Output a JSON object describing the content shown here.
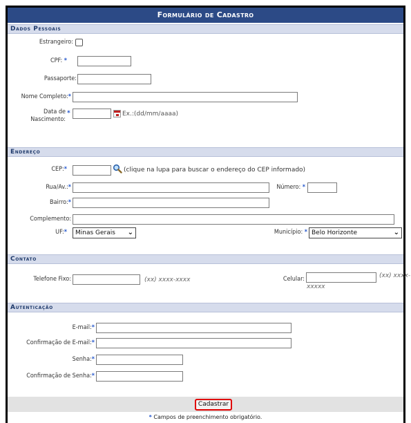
{
  "form": {
    "title": "Formulário de Cadastro",
    "required_mark": "*"
  },
  "dados_pessoais": {
    "header": "Dados Pessoais",
    "estrangeiro_label": "Estrangeiro:",
    "cpf_label": "CPF:",
    "passaporte_label": "Passaporte:",
    "nome_label": "Nome Completo:",
    "nascimento_label": "Data de Nascimento:",
    "nascimento_hint": "Ex.:(dd/mm/aaaa)"
  },
  "endereco": {
    "header": "Endereço",
    "cep_label": "CEP:",
    "cep_hint": "(clique na lupa para buscar o endereço do CEP informado)",
    "rua_label": "Rua/Av.:",
    "numero_label": "Número:",
    "bairro_label": "Bairro:",
    "complemento_label": "Complemento:",
    "uf_label": "UF:",
    "uf_value": "Minas Gerais",
    "municipio_label": "Município:",
    "municipio_value": "Belo Horizonte"
  },
  "contato": {
    "header": "Contato",
    "telefone_label": "Telefone Fixo:",
    "telefone_hint": "(xx) xxxx-xxxx",
    "celular_label": "Celular:",
    "celular_hint_1": "(xx) xxxx-",
    "celular_hint_2": "xxxxx"
  },
  "autenticacao": {
    "header": "Autenticação",
    "email_label": "E-mail:",
    "email_confirm_label": "Confirmação de E-mail:",
    "senha_label": "Senha:",
    "senha_confirm_label": "Confirmação de Senha:"
  },
  "footer": {
    "submit_label": "Cadastrar",
    "required_note": "Campos de preenchimento obrigatório."
  },
  "colors": {
    "title_bar": "#2c4a86",
    "section_header": "#d6dcec",
    "required_star": "#2255cc",
    "submit_highlight": "#e00000"
  }
}
